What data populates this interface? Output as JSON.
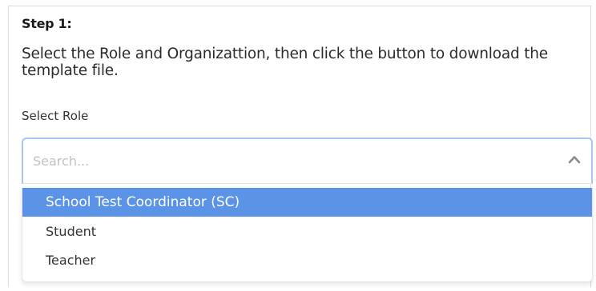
{
  "step": {
    "title": "Step 1:",
    "instruction": "Select the Role and Organizattion, then click the button to download the template file."
  },
  "role_select": {
    "label": "Select Role",
    "search_placeholder": "Search...",
    "search_value": "",
    "expanded": true,
    "toggle_icon": "chevron-up-icon",
    "options": [
      {
        "label": "School Test Coordinator (SC)",
        "highlighted": true
      },
      {
        "label": "Student",
        "highlighted": false
      },
      {
        "label": "Teacher",
        "highlighted": false
      }
    ]
  },
  "colors": {
    "highlight": "#5b94e6",
    "focus_border": "#a9c6ef",
    "placeholder": "#c2c2c2",
    "text": "#2b2b2b"
  }
}
